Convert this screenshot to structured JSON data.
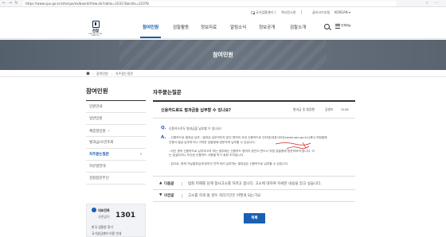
{
  "browser": {
    "nav_icons": "← → ↻",
    "url": "https://www.spo.go.kr/site/spo/ex/board/View.do?cbIdx=1031?&bcIdx=21078",
    "toolbar_icons": "☆ ⋯"
  },
  "utility": {
    "site_a": "국가검찰센터",
    "site_b": "역사전시관",
    "site_c": "글자크기조절",
    "language": "KOREAN",
    "lang_caret": "▾"
  },
  "header": {
    "logo_ko": "검찰",
    "logo_en": "PROSECUTION SERVICE",
    "menu": [
      "참여민원",
      "검찰활동",
      "정보자료",
      "알림소식",
      "정보공개",
      "검찰소개"
    ],
    "active_menu": "참여민원",
    "all_menu_label": "전체메뉴"
  },
  "banner": {
    "title": "참여민원"
  },
  "location": [
    "참여민원",
    "자주묻는질문"
  ],
  "sidebar": {
    "title": "참여민원",
    "items": [
      {
        "label": "민원안내",
        "active": false
      },
      {
        "label": "일반민원",
        "active": false
      },
      {
        "label": "체증정민원",
        "active": false,
        "ext": "↗"
      },
      {
        "label": "벌과금/사건조회",
        "active": false
      },
      {
        "label": "자주묻는질문",
        "active": true
      },
      {
        "label": "자유발언대",
        "active": false
      },
      {
        "label": "검찰칭찬주인",
        "active": false
      }
    ],
    "chevron": "›",
    "cs": {
      "label": "대표전화",
      "sub": "국번없이",
      "number": "1301",
      "more": "한국 검찰청 찾기",
      "more2": "국가상담센터 이용 안내"
    }
  },
  "main": {
    "title": "자주묻는질문",
    "question": "신용카드로도 벌과금을 납부할 수 있나요?",
    "category": "벌과금 및 형집행",
    "writer": "김병조",
    "views": "3106",
    "q_mark": "Q.",
    "q_text": "신용카드로도 벌과금을 납부할 수 있나요?",
    "a_mark": "A.",
    "answer_lines": [
      "- 신용카드로 벌과금 납부 : 벌과금 납부의무자 본인 명의의 국내 신용카드로 인터넷(대표사이트(www.spo.go.kr))에서 직접결제",
      "  인증서 발급 납부하거나 가까운 검찰청에 방문하여 납부할 수 있습니다.",
      "",
      "- 타인 명의 신용카드로 납부하고자 하는 경우에는 신용카드 명의자 본인이 반드시 직접 검찰청에 방문하여야 합니다. 이",
      "  는 분실되거나 도난된 신용카드 사용을 막기 위한 조치입니다.",
      "",
      "- 참고로, 현재 가납벌과금/추징의가 전액 미리 납부하는 벌과금은 신용카드로 납부할 수 있습니다."
    ],
    "next": {
      "arrow": "▲",
      "label": "다음글",
      "title": "범죄 피해를 당해 형사고소를 하려고 합니다. 고소에 대하여 자세한 내용을 알고 싶습니다."
    },
    "prev": {
      "arrow": "▼",
      "label": "이전글",
      "title": "고소를 하게 될 경우 처리기간은 어떻게 되는가요"
    },
    "list_button": "목록"
  },
  "colors": {
    "accent": "#1a5fb4",
    "banner": "#5f6975",
    "annotation": "#d42a2a"
  }
}
